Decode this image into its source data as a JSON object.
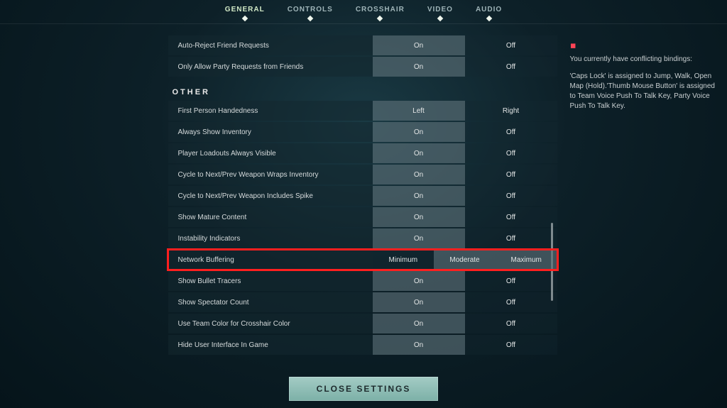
{
  "tabs": {
    "general": "GENERAL",
    "controls": "CONTROLS",
    "crosshair": "CROSSHAIR",
    "video": "VIDEO",
    "audio": "AUDIO",
    "active": "general"
  },
  "options": {
    "on": "On",
    "off": "Off"
  },
  "top_rows": {
    "auto_reject": {
      "label": "Auto-Reject Friend Requests",
      "selected": "on"
    },
    "only_party": {
      "label": "Only Allow Party Requests from Friends",
      "selected": "on"
    }
  },
  "section_other": "OTHER",
  "other_rows": {
    "handedness": {
      "label": "First Person Handedness",
      "left": "Left",
      "right": "Right",
      "selected": "left"
    },
    "inventory": {
      "label": "Always Show Inventory",
      "selected": "on"
    },
    "loadouts": {
      "label": "Player Loadouts Always Visible",
      "selected": "on"
    },
    "wraps": {
      "label": "Cycle to Next/Prev Weapon Wraps Inventory",
      "selected": "on"
    },
    "spike": {
      "label": "Cycle to Next/Prev Weapon Includes Spike",
      "selected": "on"
    },
    "mature": {
      "label": "Show Mature Content",
      "selected": "on"
    },
    "instability": {
      "label": "Instability Indicators",
      "selected": "on"
    },
    "network": {
      "label": "Network Buffering",
      "min": "Minimum",
      "mod": "Moderate",
      "max": "Maximum",
      "selected": "min"
    },
    "tracers": {
      "label": "Show Bullet Tracers",
      "selected": "on"
    },
    "spectator": {
      "label": "Show Spectator Count",
      "selected": "on"
    },
    "teamcolor": {
      "label": "Use Team Color for Crosshair Color",
      "selected": "on"
    },
    "hideui": {
      "label": "Hide User Interface In Game",
      "selected": "on"
    }
  },
  "warning": {
    "line1": "You currently have conflicting bindings:",
    "line2": "'Caps Lock' is assigned to Jump, Walk, Open Map (Hold).'Thumb Mouse Button' is assigned to Team Voice Push To Talk Key, Party Voice Push To Talk Key."
  },
  "close_label": "CLOSE SETTINGS"
}
